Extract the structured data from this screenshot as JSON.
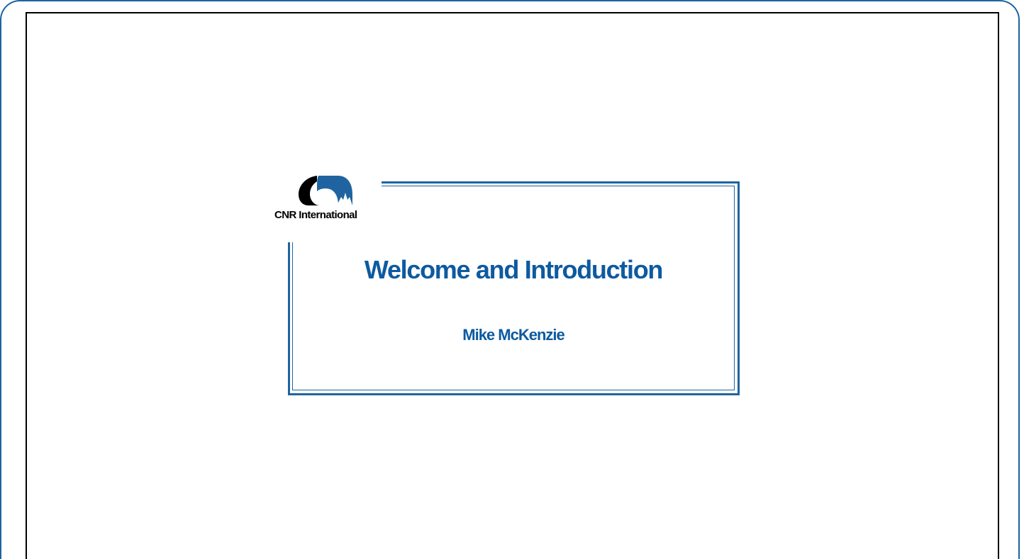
{
  "slide": {
    "logo_text": "CNR International",
    "title": "Welcome and Introduction",
    "subtitle": "Mike McKenzie"
  },
  "colors": {
    "accent": "#0d5aa0",
    "frame": "#1d63a3",
    "border": "#000000"
  },
  "icons": {
    "logo": "cnr-arc-maple-leaf-icon"
  }
}
